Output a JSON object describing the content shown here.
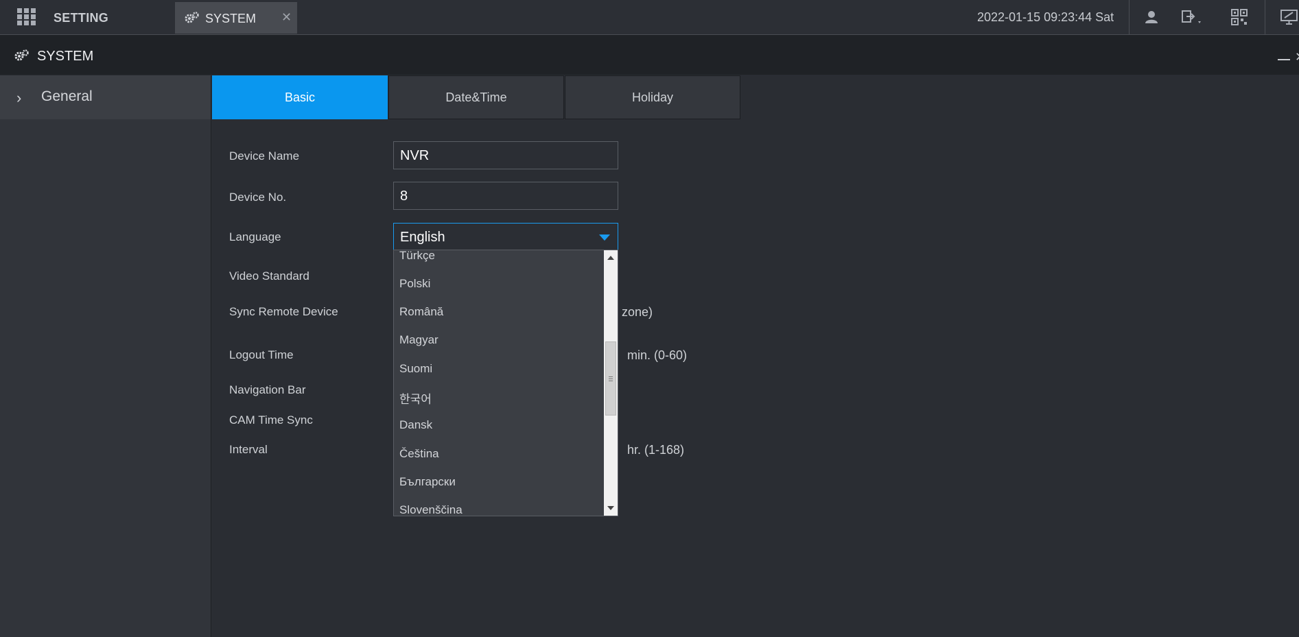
{
  "topbar": {
    "setting_label": "SETTING",
    "tab_label": "SYSTEM",
    "close_glyph": "✕",
    "datetime": "2022-01-15 09:23:44 Sat",
    "icons": [
      "grid-menu-icon",
      "gear-icon",
      "user-icon",
      "logout-icon",
      "qrcode-icon",
      "monitor-icon"
    ]
  },
  "titlebar": {
    "title": "SYSTEM",
    "close_glyph": "✕"
  },
  "sidebar": {
    "items": [
      {
        "label": "General"
      }
    ]
  },
  "tabs": [
    {
      "label": "Basic",
      "active": true
    },
    {
      "label": "Date&Time",
      "active": false
    },
    {
      "label": "Holiday",
      "active": false
    }
  ],
  "form": {
    "device_name": {
      "label": "Device Name",
      "value": "NVR"
    },
    "device_no": {
      "label": "Device No.",
      "value": "8"
    },
    "language": {
      "label": "Language",
      "value": "English"
    },
    "video_standard": {
      "label": "Video Standard"
    },
    "sync_remote_device": {
      "label": "Sync Remote Device",
      "suffix": "zone)"
    },
    "logout_time": {
      "label": "Logout Time",
      "suffix": "min. (0-60)"
    },
    "navigation_bar": {
      "label": "Navigation Bar"
    },
    "cam_time_sync": {
      "label": "CAM Time Sync"
    },
    "interval": {
      "label": "Interval",
      "suffix": "hr. (1-168)"
    }
  },
  "language_dropdown": {
    "options": [
      "Türkçe",
      "Polski",
      "Română",
      "Magyar",
      "Suomi",
      "한국어",
      "Dansk",
      "Čeština",
      "Български",
      "Slovenščina"
    ]
  },
  "colors": {
    "accent": "#0a97ef",
    "background": "#2a2d33",
    "topbar": "#2c2f35",
    "titlebar": "#1f2226"
  }
}
